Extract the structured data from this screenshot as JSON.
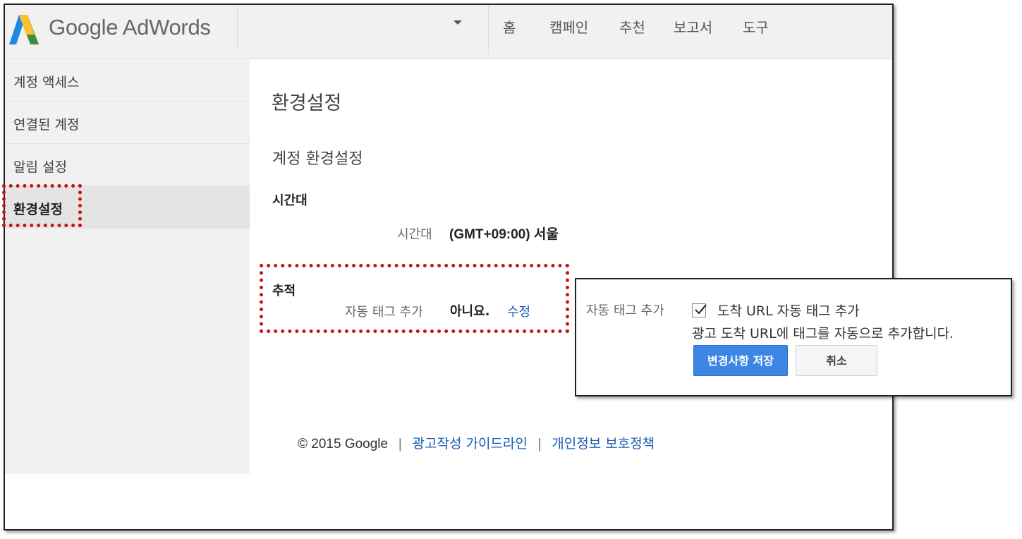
{
  "header": {
    "logo_text": "Google AdWords",
    "account_selector": "",
    "nav": [
      "홈",
      "캠페인",
      "추천",
      "보고서",
      "도구"
    ]
  },
  "sidebar": {
    "items": [
      {
        "label": "계정 액세스",
        "active": false
      },
      {
        "label": "연결된 계정",
        "active": false
      },
      {
        "label": "알림 설정",
        "active": false
      },
      {
        "label": "환경설정",
        "active": true
      }
    ]
  },
  "main": {
    "page_title": "환경설정",
    "section_title": "계정 환경설정",
    "timezone": {
      "heading": "시간대",
      "label": "시간대",
      "value": "(GMT+09:00) 서울"
    },
    "tracking": {
      "heading": "추적",
      "label": "자동 태그 추가",
      "value": "아니요.",
      "edit_link": "수정"
    }
  },
  "footer": {
    "copyright": "© 2015 Google",
    "separator": "|",
    "links": [
      "광고작성 가이드라인",
      "개인정보 보호정책"
    ]
  },
  "popup": {
    "label": "자동 태그 추가",
    "checkbox_checked": true,
    "checkbox_label": "도착 URL 자동 태그 추가",
    "description": "광고 도착 URL에 태그를 자동으로 추가합니다.",
    "save_button": "변경사항 저장",
    "cancel_button": "취소"
  },
  "colors": {
    "highlight": "#cc1111",
    "link": "#1a5fb4",
    "primary_button": "#3d86e6"
  }
}
